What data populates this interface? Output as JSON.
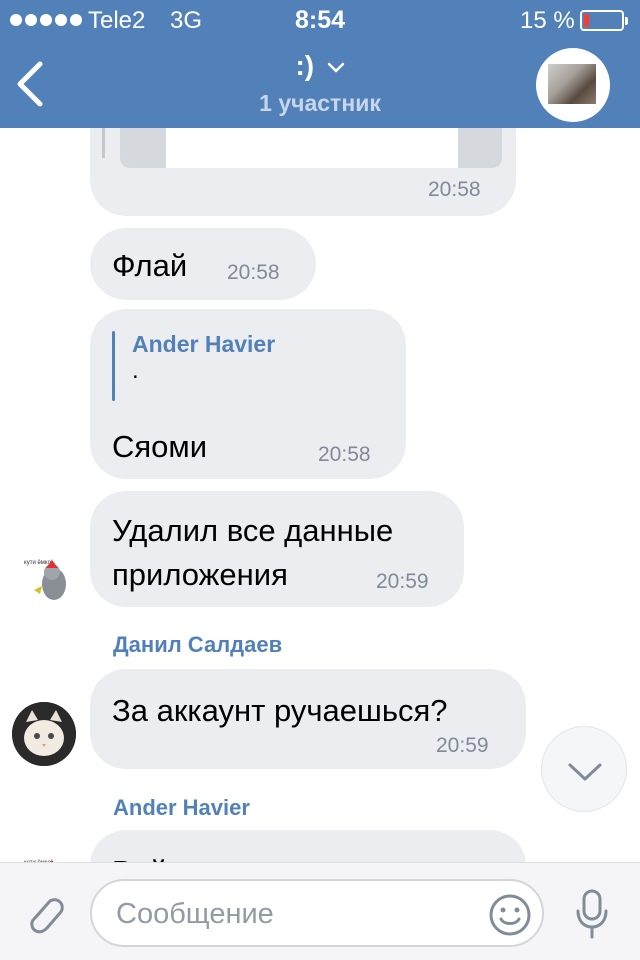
{
  "status_bar": {
    "carrier": "Tele2",
    "network": "3G",
    "time": "8:54",
    "battery_percent": "15 %",
    "battery_level": 0.15
  },
  "header": {
    "title": ":)",
    "subtitle": "1 участник"
  },
  "messages": [
    {
      "type": "attachment",
      "time": "20:58"
    },
    {
      "type": "text",
      "text": "Флай",
      "time": "20:58"
    },
    {
      "type": "reply",
      "reply_author": "Ander Havier",
      "reply_text": ".",
      "text": "Сяоми",
      "time": "20:58"
    },
    {
      "type": "text",
      "text_line1": "Удалил все данные",
      "text_line2": "приложения",
      "time": "20:59"
    },
    {
      "type": "text",
      "sender": "Данил Салдаев",
      "text": "За аккаунт ручаешься?",
      "time": "20:59"
    },
    {
      "type": "text",
      "sender": "Ander Havier",
      "text": "Вой, на аккаунте ничего вы"
    }
  ],
  "input": {
    "placeholder": "Сообщение"
  },
  "colors": {
    "header_bg": "#5181b8",
    "bubble_bg": "#ebedf0",
    "accent": "#5181b8",
    "time_text": "#828a99"
  }
}
